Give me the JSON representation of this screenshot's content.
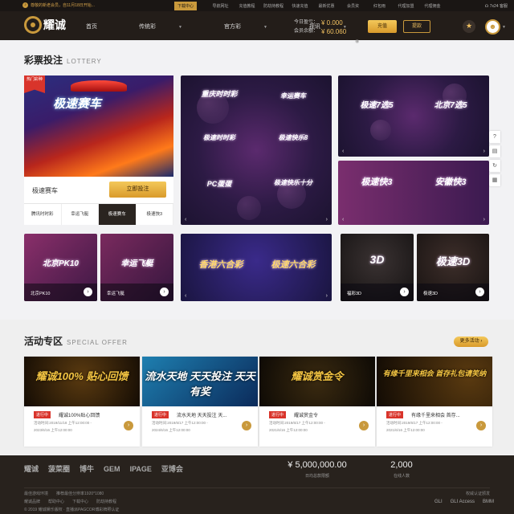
{
  "topbar": {
    "notice": "尊敬的新老会员，自11月18日开始...",
    "download": "下载中心",
    "links": [
      "导航网址",
      "充值教程",
      "防劫持教程",
      "快速充值",
      "最新优惠",
      "会员资",
      "红包雨",
      "代理加盟",
      "代理佣金"
    ],
    "service": "7x24 客服"
  },
  "nav": {
    "logo": "耀诚",
    "menu": [
      "首页",
      "传统彩",
      "官方彩",
      "视讯"
    ],
    "account_label": "今日盈亏：",
    "balance_label": "会员余额：",
    "today_pnl": "¥ 0.000",
    "balance": "¥ 60.060",
    "recharge": "充值",
    "withdraw": "提款"
  },
  "lottery": {
    "title": "彩票投注",
    "title_en": "LOTTERY",
    "hot": "热门彩种",
    "featured_title": "极速赛车",
    "featured_name": "极速赛车",
    "bet_button": "立即投注",
    "subtabs": [
      "腾讯时时彩",
      "幸运飞艇",
      "极速赛车",
      "极速快3"
    ],
    "tile1": [
      "重庆时时彩",
      "幸运赛车",
      "极速时时彩",
      "极速快乐8",
      "PC蛋蛋",
      "极速快乐十分"
    ],
    "tile2": [
      "极速7选5",
      "北京7选5"
    ],
    "tile3": [
      "极速快3",
      "安徽快3"
    ],
    "row2": [
      {
        "art": "北京PK10",
        "label": "北京PK10"
      },
      {
        "art": "幸运飞艇",
        "label": "幸运飞艇"
      },
      {
        "art": "香港六合彩",
        "label": ""
      },
      {
        "art": "极速六合彩",
        "label": ""
      },
      {
        "art": "3D",
        "label": "福彩3D"
      },
      {
        "art": "极速3D",
        "label": "极速3D"
      }
    ]
  },
  "offer": {
    "title": "活动专区",
    "title_en": "SPECIAL OFFER",
    "more": "更多活动",
    "status": "进行中",
    "items": [
      {
        "cap": "耀诚100% 贴心回馈",
        "title": "耀诚100%贴心回馈",
        "d1": "活动时间:2019/11/18 上午12:00:00 -",
        "d2": "2023/6/16 上午12:00:00"
      },
      {
        "cap": "流水天地 天天投注 天天有奖",
        "title": "流水天地 天天投注 天...",
        "d1": "活动时间:2019/6/17 上午12:00:00 -",
        "d2": "2024/6/16 上午12:00:00"
      },
      {
        "cap": "耀诚赏金令",
        "title": "耀诚赏金令",
        "d1": "活动时间:2019/6/17 上午12:00:00 -",
        "d2": "2021/6/16 上午12:00:00"
      },
      {
        "cap": "有缘千里来相会 首存礼包请笑纳",
        "title": "有缘千里来相会 首存...",
        "d1": "活动时间:2019/6/17 上午12:00:00 -",
        "d2": "2021/6/16 上午12:00:00"
      }
    ]
  },
  "footer": {
    "brands": [
      "耀诚",
      "菠菜圈",
      "博牛",
      "GEM",
      "IPAGE",
      "亚博会"
    ],
    "amount": "¥ 5,000,000.00",
    "amount_label": "日均总款限额",
    "count": "2,000",
    "count_label": "在线人数",
    "links1": [
      "最佳游戏环境",
      "推荐最佳分辨率1920*1080"
    ],
    "links2": [
      "耀诚品牌",
      "帮助中心",
      "下载中心",
      "防劫持教程"
    ],
    "cert": "权威认证颁发",
    "copyright": "© 2019 耀诚娱乐版权 · 直播派PAGCOR博彩牌照认证",
    "cert_logos": [
      "GLI",
      "GLI Access",
      "BMM"
    ]
  }
}
